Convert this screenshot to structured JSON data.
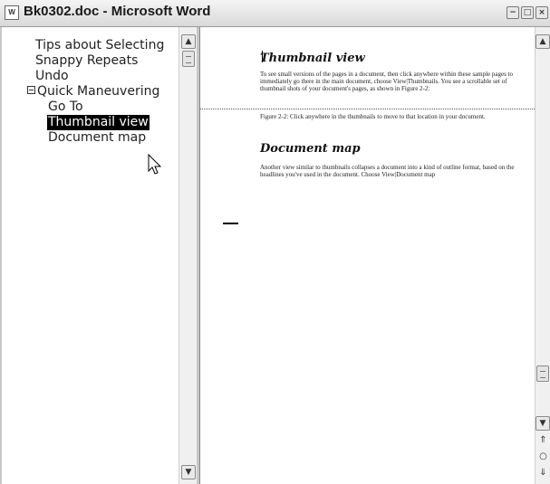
{
  "window": {
    "title": "Bk0302.doc - Microsoft Word",
    "app_icon_text": "W"
  },
  "title_buttons": {
    "minimize": "−",
    "maximize": "□",
    "close": "×"
  },
  "document_map": {
    "items": [
      {
        "label": "Tips about Selecting",
        "level": 1
      },
      {
        "label": "Snappy Repeats",
        "level": 1
      },
      {
        "label": "Undo",
        "level": 1
      },
      {
        "label": "Quick Maneuvering",
        "level": 1,
        "expanded": true
      },
      {
        "label": "Go To",
        "level": 2
      },
      {
        "label": "Thumbnail view",
        "level": 2,
        "selected": true
      },
      {
        "label": "Document map",
        "level": 2
      }
    ]
  },
  "document": {
    "sections": [
      {
        "heading": "Thumbnail view",
        "body": "To see small versions of the pages in a document, then click anywhere within these sample pages to immediately go there in the main document, choose View|Thumbnails. You see a scrollable set of thumbnail shots of your document's pages, as shown in Figure 2-2:"
      }
    ],
    "figure_caption": "Figure 2-2: Click anywhere in the thumbnails to move to that location in your document.",
    "section2_heading": "Document map",
    "section2_body": "Another view similar to thumbnails collapses a document into a kind of outline format, based on the headlines you've used in the document. Choose View|Document map"
  },
  "scroll_arrows": {
    "up": "▲",
    "down": "▼"
  },
  "browse_buttons": {
    "previous": "⇑",
    "select_object": "○",
    "next": "⇓"
  },
  "colors": {
    "selection_bg": "#000000",
    "selection_fg": "#ffffff",
    "titlebar": "#dcdcdc"
  }
}
